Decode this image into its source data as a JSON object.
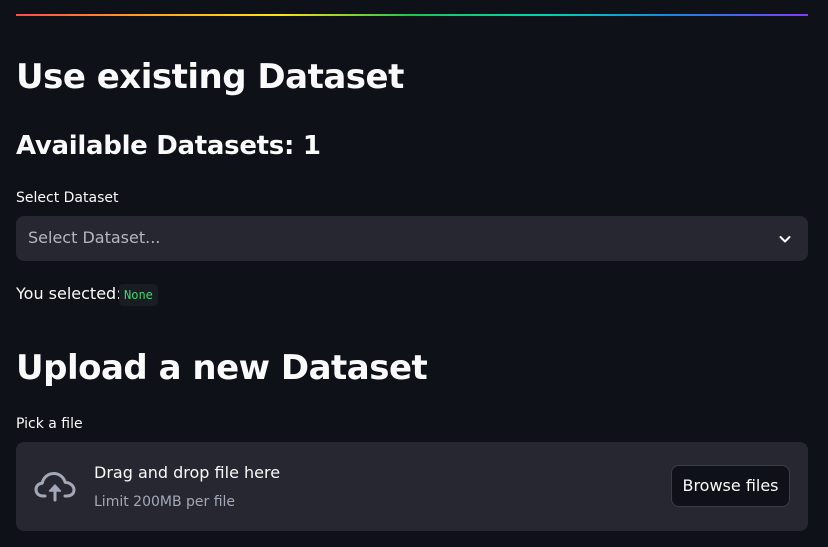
{
  "divider_colors": [
    "#ff4b4b",
    "#ffa421",
    "#ffe312",
    "#21c354",
    "#00d4b1",
    "#1c83e1",
    "#803df5"
  ],
  "existing_section": {
    "title": "Use existing Dataset",
    "available_heading": "Available Datasets: 1",
    "select_label": "Select Dataset",
    "select_placeholder": "Select Dataset...",
    "select_icon": "chevron-down-icon",
    "selected_prefix": "You selected:",
    "selected_value": "None"
  },
  "upload_section": {
    "title": "Upload a new Dataset",
    "file_label": "Pick a file",
    "dropzone_icon": "cloud-upload-icon",
    "dropzone_text": "Drag and drop file here",
    "dropzone_limit": "Limit 200MB per file",
    "browse_label": "Browse files"
  },
  "colors": {
    "background": "#0e1117",
    "surface": "#262730",
    "text": "#fafafa",
    "code_green": "#3dd56d"
  }
}
